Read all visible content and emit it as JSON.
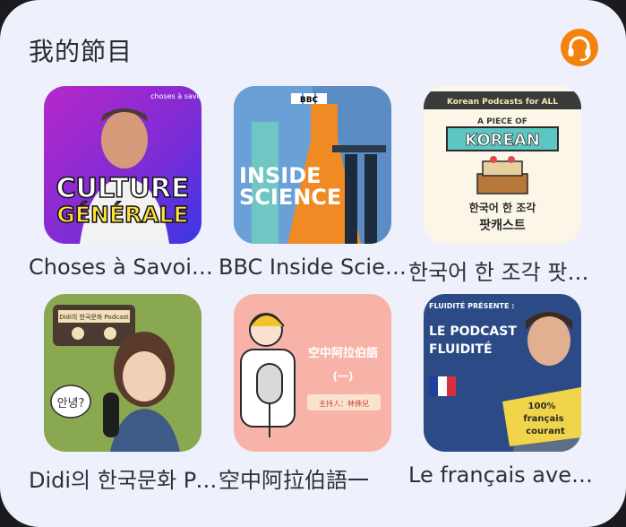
{
  "widget": {
    "title": "我的節目",
    "app_icon": "castbox-headphones-icon",
    "accent_color": "#f5820d",
    "background_color": "#eef0fb"
  },
  "podcasts": [
    {
      "title": "Choses à Savoir CULTURE GÉNÉRALE",
      "cover_text_1": "CULTURE",
      "cover_text_2": "GÉNÉRALE",
      "cover_badge": "choses à savoir"
    },
    {
      "title": "BBC Inside Science",
      "cover_text_1": "BBC",
      "cover_text_2": "INSIDE",
      "cover_text_3": "SCIENCE"
    },
    {
      "title": "한국어 한 조각 팟캐스트",
      "cover_text_1": "Korean Podcasts for ALL",
      "cover_text_2": "A PIECE OF",
      "cover_text_3": "KOREAN",
      "cover_text_4": "한국어 한 조각",
      "cover_text_5": "팟캐스트"
    },
    {
      "title": "Didi의 한국문화 Podcast",
      "cover_text_1": "Didi의 한국문화 Podcast",
      "cover_text_2": "안녕?"
    },
    {
      "title": "空中阿拉伯語一",
      "cover_text_1": "空中阿拉伯語",
      "cover_text_2": "(一)",
      "cover_text_3": "主持人：林佛兒"
    },
    {
      "title": "Le français avec Fluidité",
      "cover_text_1": "FLUIDITÉ PRÉSENTE :",
      "cover_text_2": "LE PODCAST",
      "cover_text_3": "FLUIDITÉ",
      "cover_text_4": "100%",
      "cover_text_5": "français",
      "cover_text_6": "courant"
    }
  ]
}
